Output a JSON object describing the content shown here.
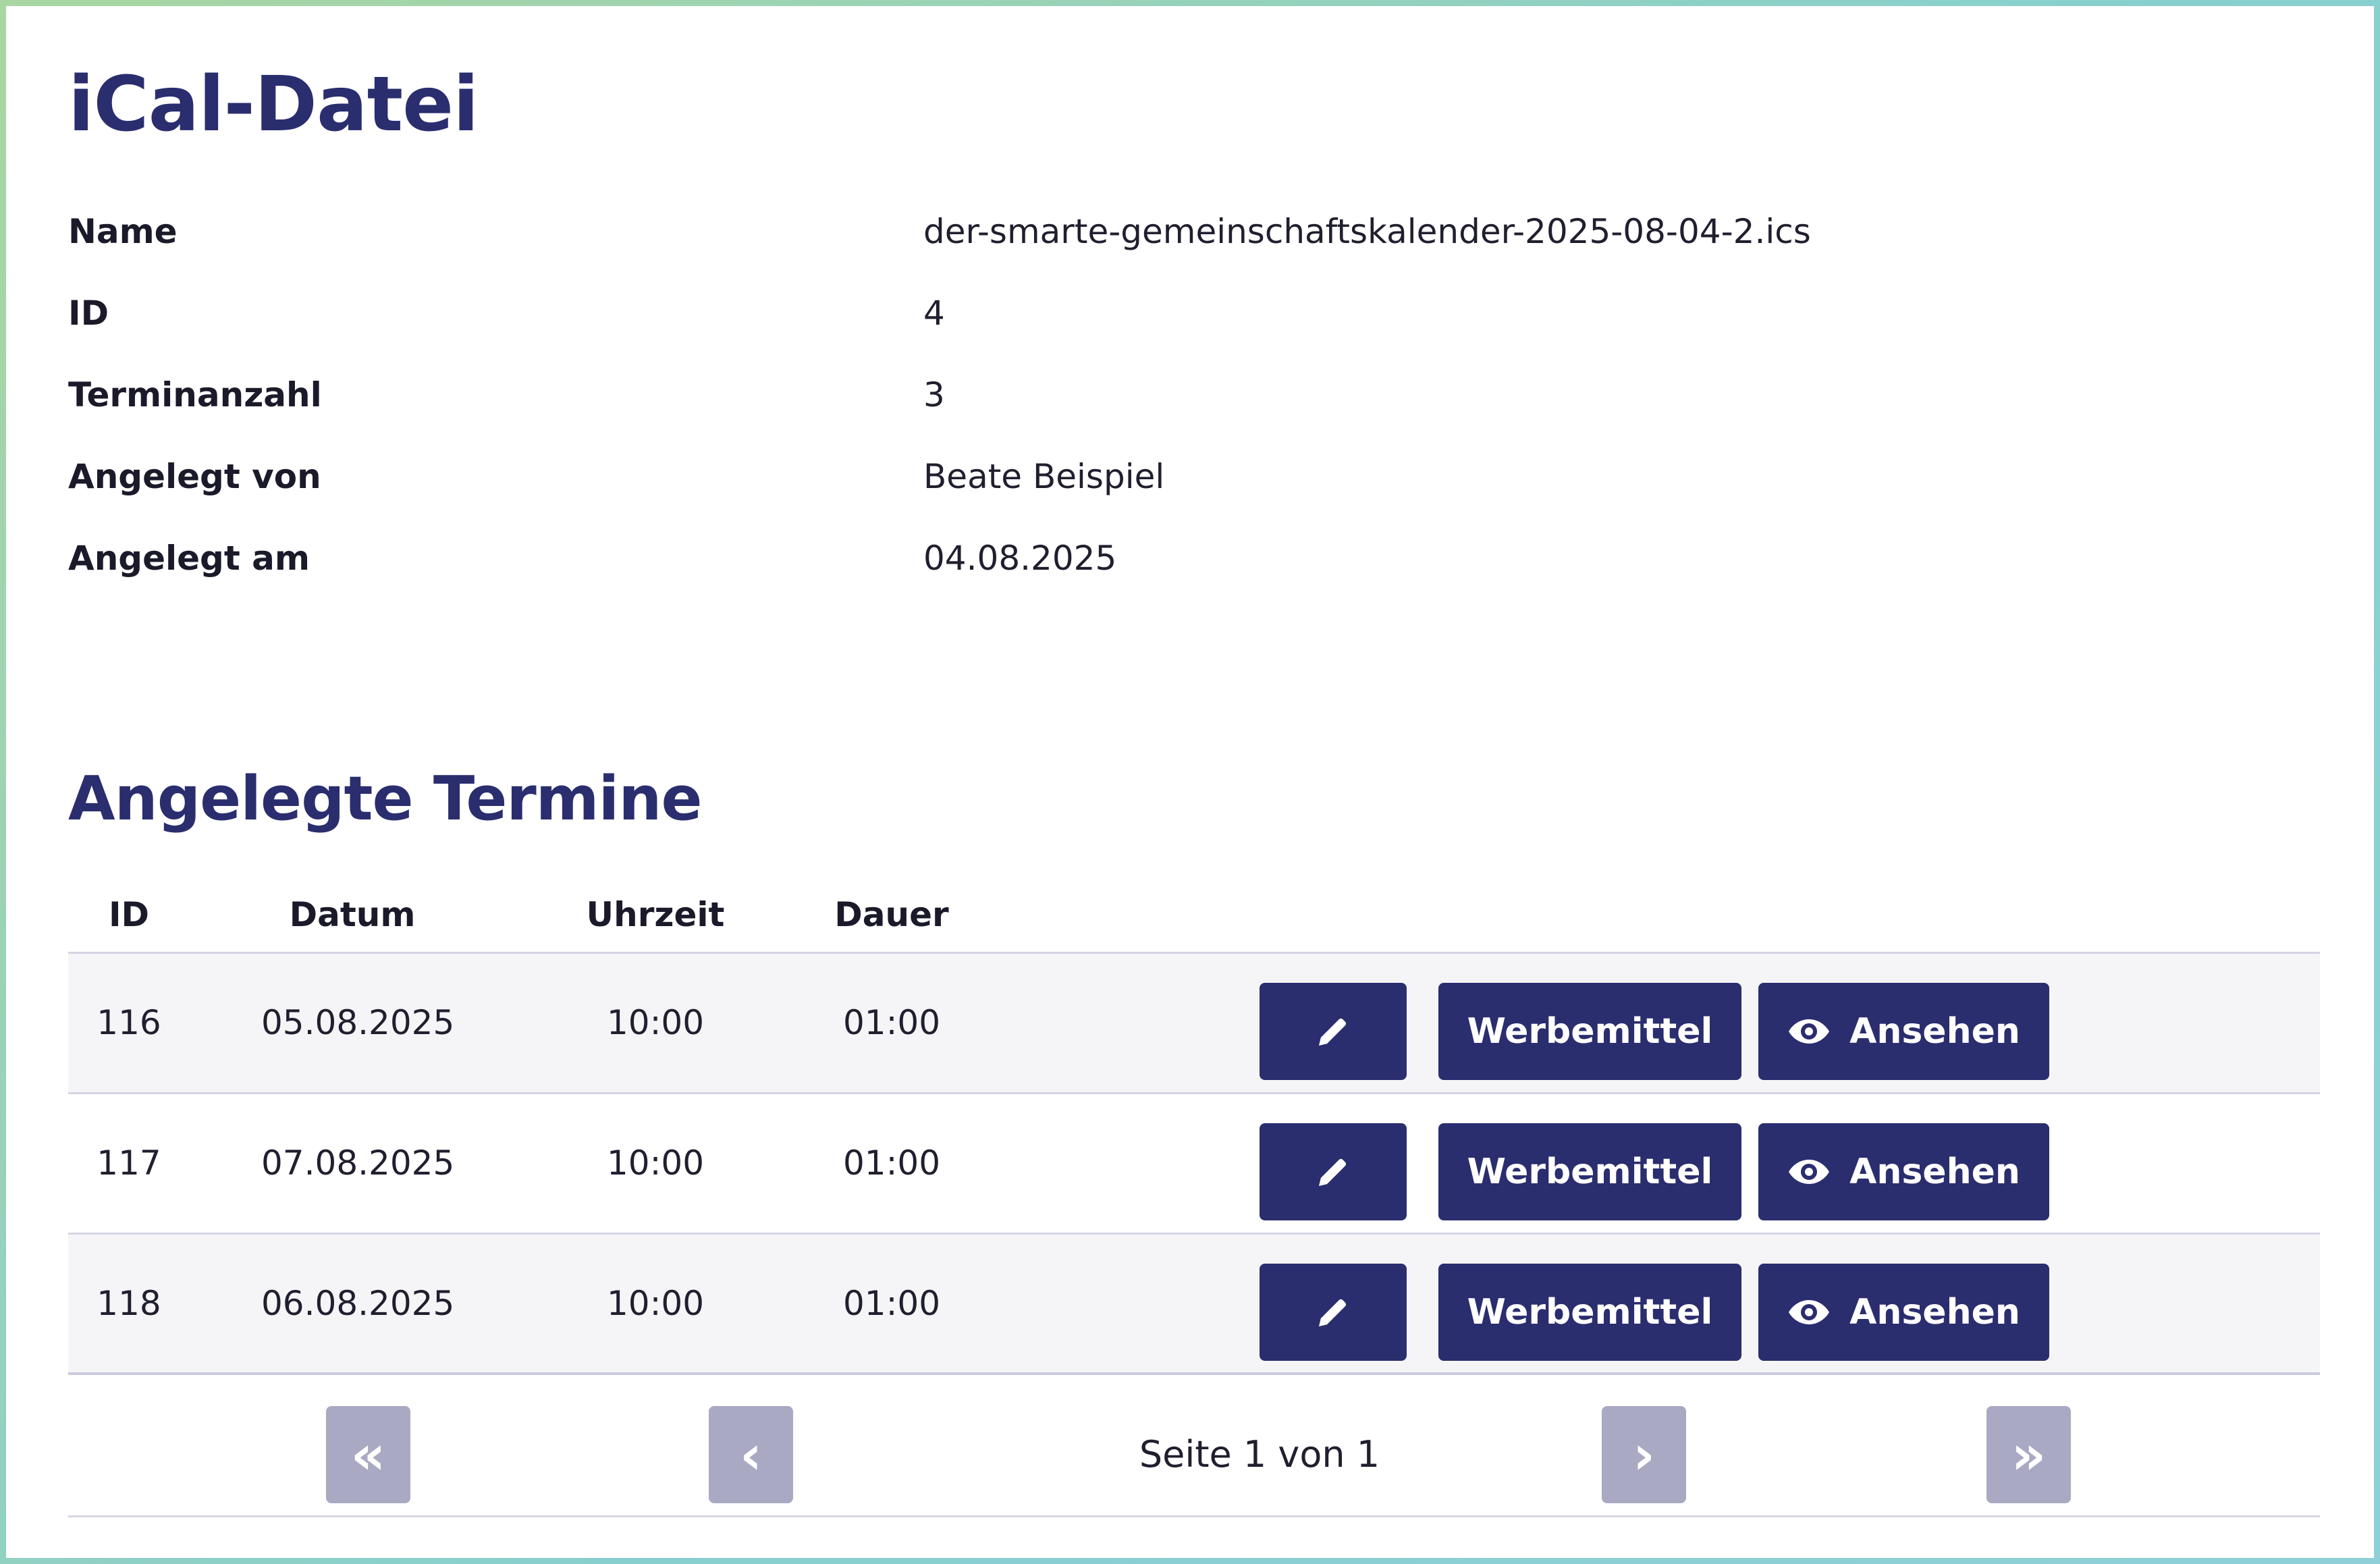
{
  "page": {
    "title": "iCal-Datei"
  },
  "details": [
    {
      "label": "Name",
      "value": "der-smarte-gemeinschaftskalender-2025-08-04-2.ics"
    },
    {
      "label": "ID",
      "value": "4"
    },
    {
      "label": "Terminanzahl",
      "value": "3"
    },
    {
      "label": "Angelegt von",
      "value": "Beate Beispiel"
    },
    {
      "label": "Angelegt am",
      "value": "04.08.2025"
    }
  ],
  "events": {
    "title": "Angelegte Termine",
    "columns": {
      "id": "ID",
      "date": "Datum",
      "time": "Uhrzeit",
      "duration": "Dauer"
    },
    "rows": [
      {
        "id": "116",
        "date": "05.08.2025",
        "time": "10:00",
        "duration": "01:00"
      },
      {
        "id": "117",
        "date": "07.08.2025",
        "time": "10:00",
        "duration": "01:00"
      },
      {
        "id": "118",
        "date": "06.08.2025",
        "time": "10:00",
        "duration": "01:00"
      }
    ],
    "actions": {
      "edit_icon": "pencil-icon",
      "promo_label": "Werbemittel",
      "view_icon": "eye-icon",
      "view_label": "Ansehen"
    }
  },
  "pagination": {
    "first": "«",
    "prev": "‹",
    "status": "Seite 1 von 1",
    "next": "›",
    "last": "»"
  },
  "colors": {
    "primary": "#2a2d6e",
    "disabled": "#a9a9c3",
    "row_alt": "#f5f5f8"
  }
}
